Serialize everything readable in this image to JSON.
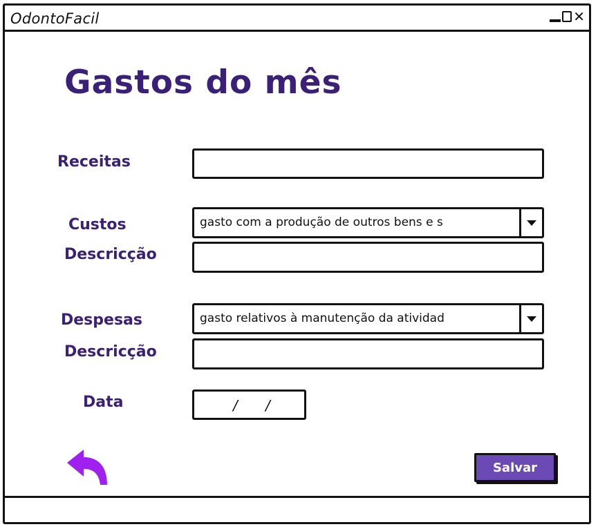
{
  "window": {
    "title": "OdontoFacil",
    "controls": [
      "minimize-icon",
      "maximize-icon",
      "close-icon"
    ],
    "close_glyph": "✕"
  },
  "page": {
    "heading": "Gastos do mês"
  },
  "form": {
    "receitas_label": "Receitas",
    "receitas_value": "",
    "custos_label": "Custos",
    "custos_selected": "gasto com a produção de outros bens e s",
    "custos_descricao_label": "Descricção",
    "custos_descricao_value": "",
    "despesas_label": "Despesas",
    "despesas_selected": "gasto relativos à manutenção da atividad",
    "despesas_descricao_label": "Descricção",
    "despesas_descricao_value": "",
    "data_label": "Data",
    "data_sep1": "/",
    "data_sep2": "/"
  },
  "actions": {
    "back_icon": "back-arrow-icon",
    "save_label": "Salvar"
  },
  "colors": {
    "accent_text": "#3b2078",
    "save_button": "#6c4ab5",
    "back_arrow": "#a020f0"
  }
}
